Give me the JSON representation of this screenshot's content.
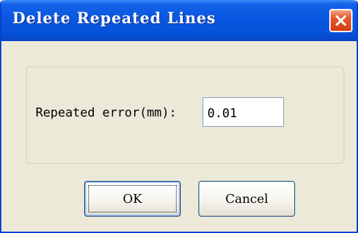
{
  "window": {
    "title": "Delete Repeated Lines",
    "close_icon": "close-icon"
  },
  "form": {
    "label": "Repeated error(mm):",
    "value": "0.01"
  },
  "buttons": {
    "ok_label": "OK",
    "cancel_label": "Cancel"
  },
  "colors": {
    "titlebar": "#0a56e0",
    "close_button": "#d63d12",
    "dialog_background": "#ece9d8"
  }
}
